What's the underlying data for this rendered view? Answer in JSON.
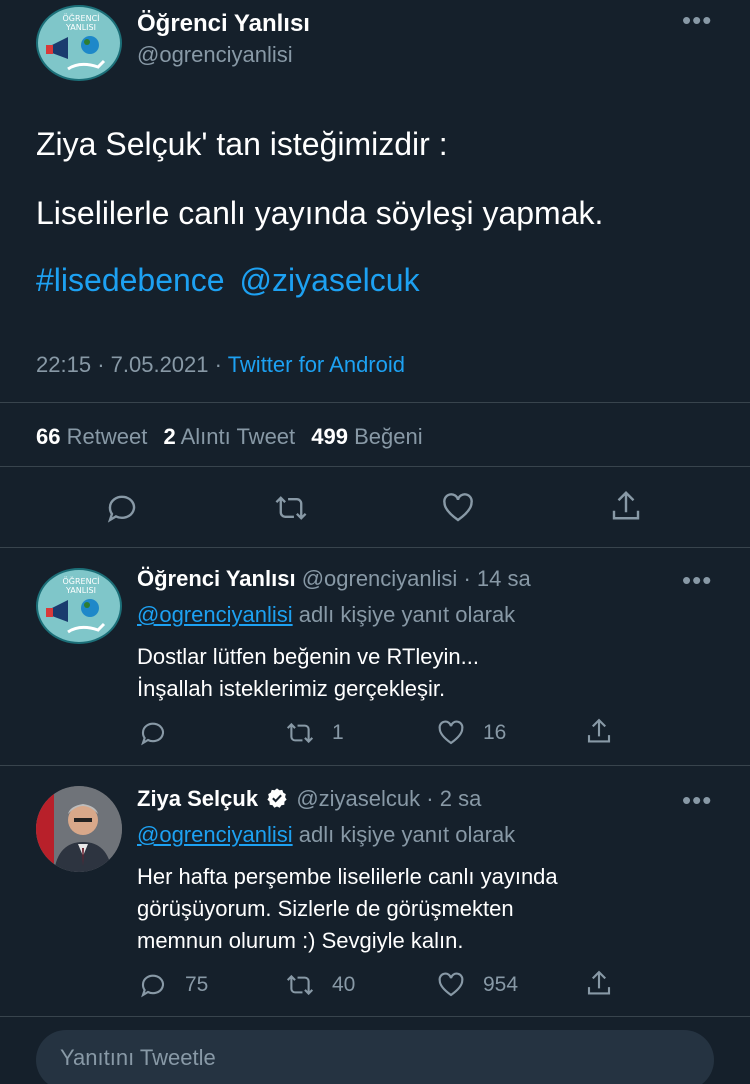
{
  "main_tweet": {
    "author_name": "Öğrenci Yanlısı",
    "author_handle": "@ogrenciyanlisi",
    "line1": "Ziya Selçuk' tan isteğimizdir :",
    "line2": "Liselilerle canlı yayında söyleşi yapmak.",
    "hashtag": "#lisedebence",
    "mention": "@ziyaselcuk",
    "time": "22:15",
    "date": "7.05.2021",
    "source": "Twitter for Android",
    "separator": "·",
    "stats": {
      "retweets_count": "66",
      "retweets_label": "Retweet",
      "quotes_count": "2",
      "quotes_label": "Alıntı Tweet",
      "likes_count": "499",
      "likes_label": "Beğeni"
    },
    "avatar_text_line1": "ÖĞRENCİ",
    "avatar_text_line2": "YANLISI"
  },
  "replies": [
    {
      "author_name": "Öğrenci Yanlısı",
      "author_handle": "@ogrenciyanlisi",
      "time_ago": "· 14 sa",
      "reply_to_handle": "@ogrenciyanlisi",
      "reply_to_suffix": "adlı kişiye yanıt olarak",
      "text_line1": "Dostlar lütfen beğenin ve RTleyin...",
      "text_line2": "İnşallah isteklerimiz gerçekleşir.",
      "reply_count": "",
      "retweet_count": "1",
      "like_count": "16",
      "avatar_text_line1": "ÖĞRENCİ",
      "avatar_text_line2": "YANLISI"
    },
    {
      "author_name": "Ziya Selçuk",
      "author_handle": "@ziyaselcuk",
      "time_ago": "· 2 sa",
      "reply_to_handle": "@ogrenciyanlisi",
      "reply_to_suffix": "adlı kişiye yanıt olarak",
      "text_line1": "Her hafta perşembe liselilerle canlı yayında",
      "text_line2": "görüşüyorum. Sizlerle de görüşmekten",
      "text_line3": "memnun olurum :) Sevgiyle kalın.",
      "reply_count": "75",
      "retweet_count": "40",
      "like_count": "954"
    }
  ],
  "reply_input": {
    "placeholder": "Yanıtını Tweetle"
  },
  "more_glyph": "•••",
  "colors": {
    "background": "#15202b",
    "link": "#1da1f2",
    "secondary_text": "#8899a6",
    "divider": "#38444d",
    "verified": "#ffffff"
  },
  "icons": [
    "reply-icon",
    "retweet-icon",
    "like-icon",
    "share-icon",
    "more-icon",
    "verified-badge-icon"
  ]
}
